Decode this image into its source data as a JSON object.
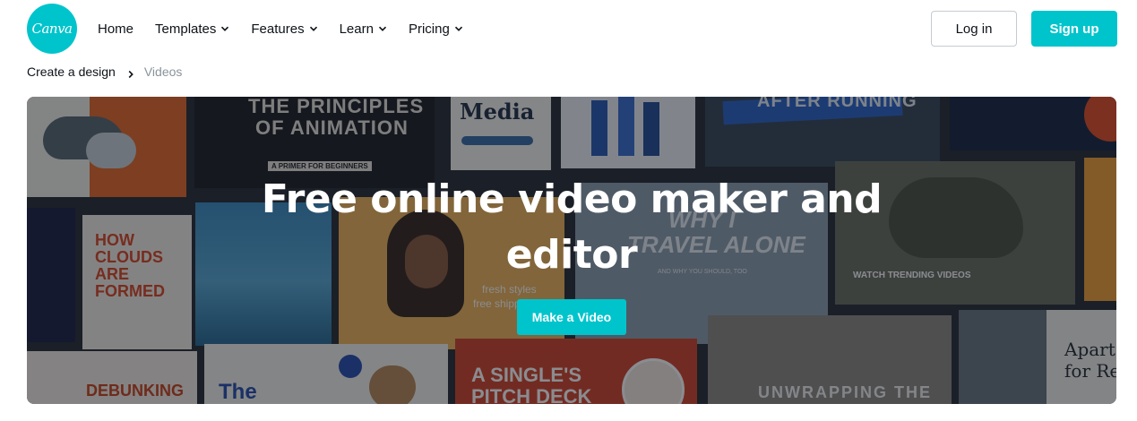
{
  "brand": {
    "logo_text": "Canva",
    "accent_color": "#00c4cc"
  },
  "nav": {
    "items": [
      {
        "label": "Home",
        "has_dropdown": false
      },
      {
        "label": "Templates",
        "has_dropdown": true
      },
      {
        "label": "Features",
        "has_dropdown": true
      },
      {
        "label": "Learn",
        "has_dropdown": true
      },
      {
        "label": "Pricing",
        "has_dropdown": true
      }
    ],
    "login_label": "Log in",
    "signup_label": "Sign up"
  },
  "breadcrumb": {
    "parent": "Create a design",
    "current": "Videos"
  },
  "hero": {
    "title_line1": "Free online video maker and",
    "title_line2": "editor",
    "cta_label": "Make a Video",
    "templates": {
      "t1": "THE PRINCIPLES",
      "t2": "OF ANIMATION",
      "t3": "A PRIMER FOR BEGINNERS",
      "t4": "Media",
      "t5": "AFTER RUNNING",
      "t6": "HOW",
      "t7": "CLOUDS",
      "t8": "ARE",
      "t9": "FORMED",
      "t10": "WHY I",
      "t11": "TRAVEL ALONE",
      "t12": "AND WHY YOU SHOULD, TOO",
      "t13": "fresh styles",
      "t14": "free shipping",
      "t15": "WATCH TRENDING VIDEOS",
      "t16": "DEBUNKING",
      "t17": "The",
      "t18": "A SINGLE'S",
      "t19": "PITCH DECK",
      "t20": "UNWRAPPING THE",
      "t21": "Apart",
      "t22": "for Re"
    }
  }
}
